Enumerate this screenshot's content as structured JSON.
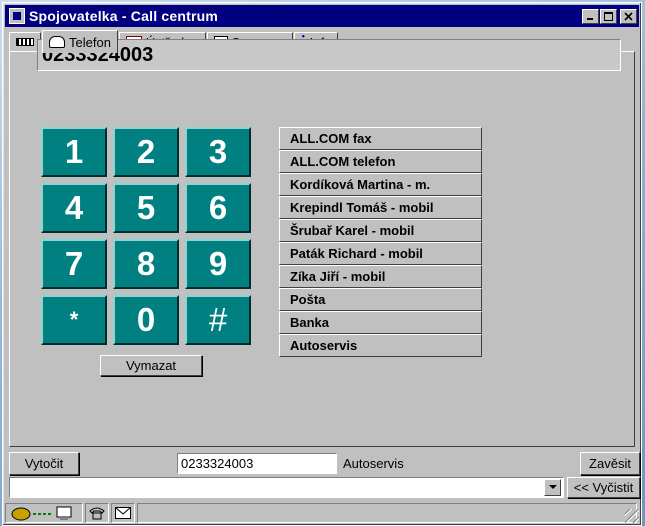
{
  "window": {
    "title": "Spojovatelka - Call centrum"
  },
  "tabs": [
    {
      "label": "",
      "icon": "phone-line-icon"
    },
    {
      "label": "Telefon",
      "icon": "telephone-icon"
    },
    {
      "label": "Ústředna",
      "icon": "switchboard-icon"
    },
    {
      "label": "Seznamy",
      "icon": "book-icon"
    },
    {
      "label": "Info",
      "icon": "info-icon"
    }
  ],
  "display": {
    "number": "0233324003"
  },
  "keypad": {
    "keys": [
      "1",
      "2",
      "3",
      "4",
      "5",
      "6",
      "7",
      "8",
      "9",
      "*",
      "0",
      "#"
    ],
    "color": "#008080"
  },
  "clear_button": {
    "label": "Vymazat"
  },
  "speed_dial": [
    "ALL.COM fax",
    "ALL.COM telefon",
    "Kordíková Martina - m.",
    "Krepindl Tomáš - mobil",
    "Šrubař Karel - mobil",
    "Paták Richard - mobil",
    "Zíka Jiří - mobil",
    "Pošta",
    "Banka",
    "Autoservis"
  ],
  "call_bar": {
    "dial_label": "Vytočit",
    "number_value": "0233324003",
    "contact_name": "Autoservis",
    "hangup_label": "Zavěsit"
  },
  "log_bar": {
    "value": "",
    "clear_label": "<< Vyčistit"
  },
  "status_icons": [
    "call-transfer-icon",
    "telephone-icon",
    "envelope-icon"
  ],
  "colors": {
    "titlebar": "#000080",
    "key": "#008080",
    "window": "#c0c0c0"
  }
}
